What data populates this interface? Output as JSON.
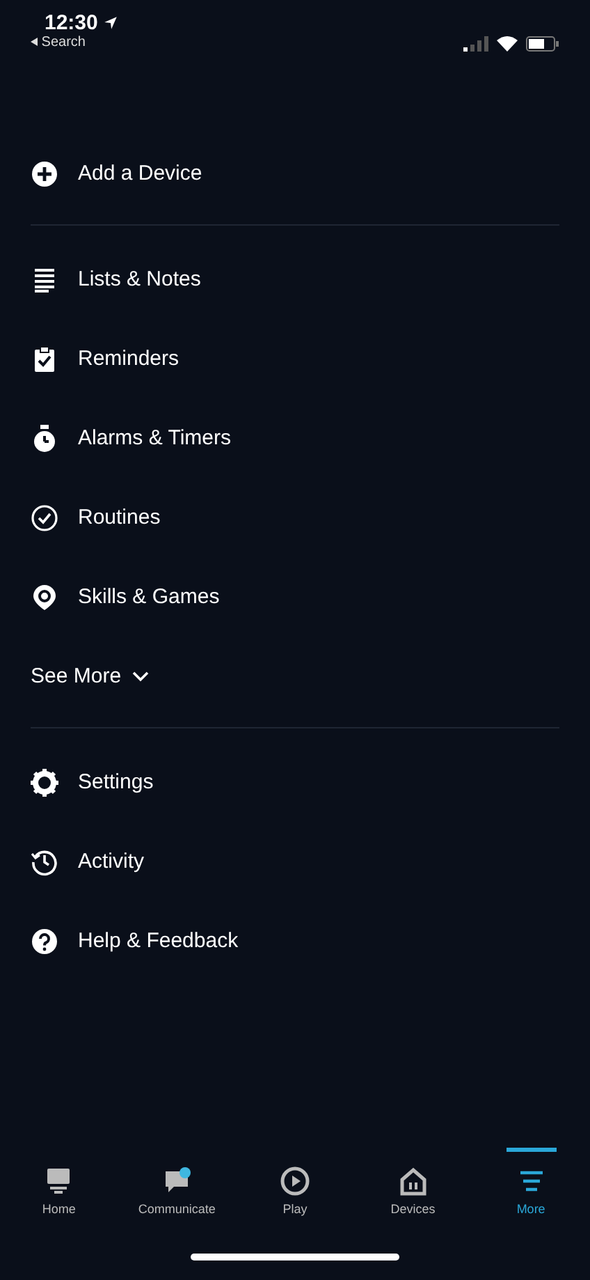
{
  "status_bar": {
    "time": "12:30",
    "back_label": "Search"
  },
  "top_items": [
    {
      "label": "Add a Device"
    }
  ],
  "main_items": [
    {
      "label": "Lists & Notes"
    },
    {
      "label": "Reminders"
    },
    {
      "label": "Alarms & Timers"
    },
    {
      "label": "Routines"
    },
    {
      "label": "Skills & Games"
    }
  ],
  "see_more": {
    "label": "See More",
    "expanded": false
  },
  "bottom_items": [
    {
      "label": "Settings"
    },
    {
      "label": "Activity"
    },
    {
      "label": "Help & Feedback"
    }
  ],
  "tabs": [
    {
      "label": "Home",
      "selected": false
    },
    {
      "label": "Communicate",
      "selected": false
    },
    {
      "label": "Play",
      "selected": false
    },
    {
      "label": "Devices",
      "selected": false
    },
    {
      "label": "More",
      "selected": true
    }
  ]
}
